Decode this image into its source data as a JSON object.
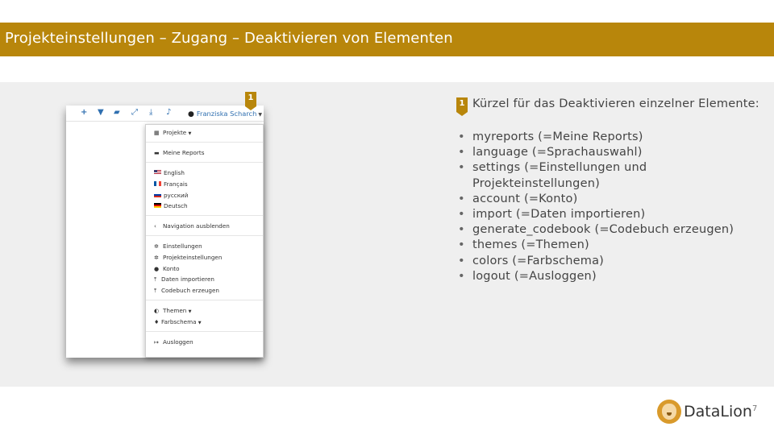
{
  "slide": {
    "title": "Projekteinstellungen – Zugang – Deaktivieren von Elementen",
    "page_number": "7",
    "brand": "DataLion",
    "accent_color": "#b8860b"
  },
  "screenshot": {
    "toolbar_icons": [
      "plus-icon",
      "filter-icon",
      "folder-open-icon",
      "expand-icon",
      "download-icon",
      "bell-icon"
    ],
    "user_name": "Franziska Scharch",
    "menu": {
      "projects": "Projekte",
      "my_reports": "Meine Reports",
      "languages": [
        "English",
        "Français",
        "русский",
        "Deutsch"
      ],
      "hide_navigation": "Navigation ausblenden",
      "settings": "Einstellungen",
      "project_settings": "Projekteinstellungen",
      "account": "Konto",
      "import_data": "Daten importieren",
      "generate_codebook": "Codebuch erzeugen",
      "themes": "Themen",
      "colors": "Farbschema",
      "logout": "Ausloggen"
    }
  },
  "markers": {
    "a": "1",
    "b": "1"
  },
  "description": "Kürzel für das Deaktivieren einzelner Elemente:",
  "shortcuts": [
    "myreports (=Meine Reports)",
    "language (=Sprachauswahl)",
    "settings (=Einstellungen und Projekteinstellungen)",
    "account (=Konto)",
    "import (=Daten importieren)",
    "generate_codebook (=Codebuch erzeugen)",
    "themes (=Themen)",
    "colors (=Farbschema)",
    "logout (=Ausloggen)"
  ]
}
